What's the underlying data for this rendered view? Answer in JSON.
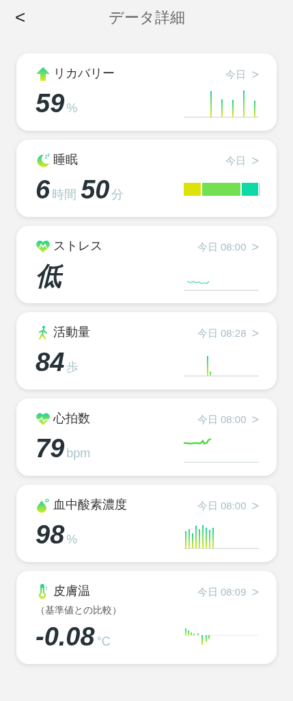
{
  "header": {
    "back": "<",
    "title": "データ詳細"
  },
  "cards": [
    {
      "title": "リカバリー",
      "time": "今日",
      "chevron": ">",
      "value": [
        {
          "kind": "number",
          "text": "59"
        },
        {
          "kind": "unit",
          "text": "%"
        }
      ]
    },
    {
      "title": "睡眠",
      "time": "今日",
      "chevron": ">",
      "value": [
        {
          "kind": "number",
          "text": "6"
        },
        {
          "kind": "unit",
          "text": "時間"
        },
        {
          "kind": "number",
          "text": "50"
        },
        {
          "kind": "unit",
          "text": "分"
        }
      ]
    },
    {
      "title": "ストレス",
      "time": "今日 08:00",
      "chevron": ">",
      "value": [
        {
          "kind": "number",
          "text": "低"
        }
      ]
    },
    {
      "title": "活動量",
      "time": "今日 08:28",
      "chevron": ">",
      "value": [
        {
          "kind": "number",
          "text": "84"
        },
        {
          "kind": "unit",
          "text": "歩"
        }
      ]
    },
    {
      "title": "心拍数",
      "time": "今日 08:00",
      "chevron": ">",
      "value": [
        {
          "kind": "number",
          "text": "79"
        },
        {
          "kind": "unit",
          "text": "bpm"
        }
      ]
    },
    {
      "title": "血中酸素濃度",
      "time": "今日 08:00",
      "chevron": ">",
      "value": [
        {
          "kind": "number",
          "text": "98"
        },
        {
          "kind": "unit",
          "text": "%"
        }
      ]
    },
    {
      "title": "皮膚温",
      "subtitle": "（基準値との比較）",
      "time": "今日 08:09",
      "chevron": ">",
      "value": [
        {
          "kind": "number",
          "text": "-0.08"
        },
        {
          "kind": "unit",
          "text": "°C"
        }
      ]
    }
  ]
}
